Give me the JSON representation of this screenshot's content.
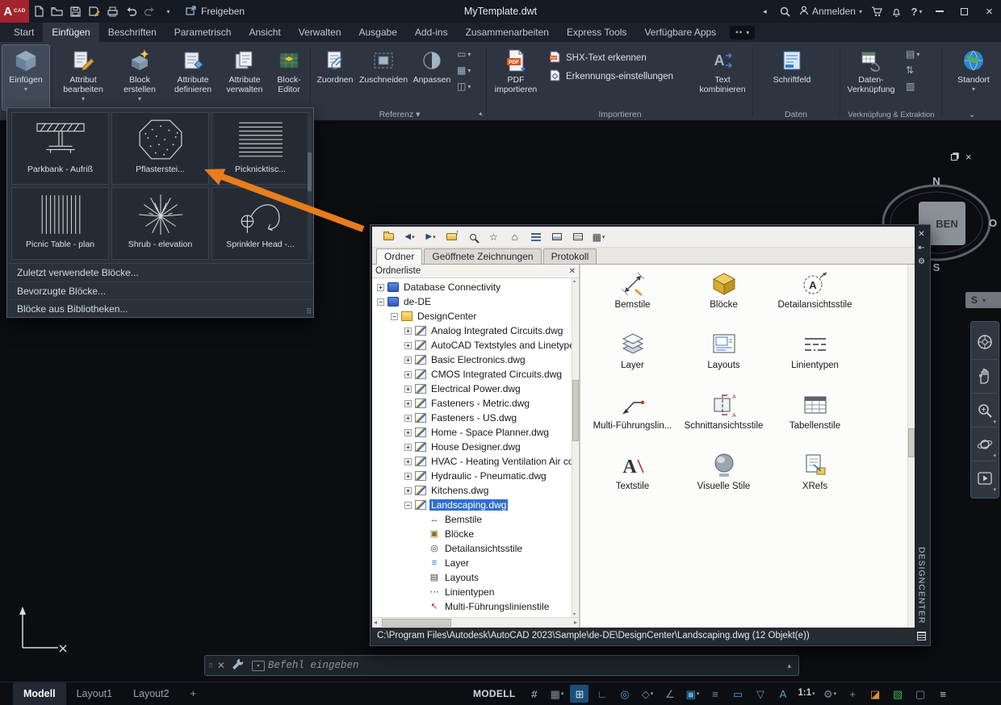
{
  "colors": {
    "annotation_arrow": "#e87d1c",
    "selection_blue": "#2f6fce",
    "status_active_blue": "#4da6e0",
    "ribbon_bg": "#2e3440",
    "titlebar_bg": "#151a23"
  },
  "titlebar": {
    "logo_letter": "A",
    "logo_sub": "CAD",
    "share_label": "Freigeben",
    "title": "MyTemplate.dwt",
    "signin_label": "Anmelden"
  },
  "tabs": [
    {
      "label": "Start"
    },
    {
      "label": "Einfügen",
      "state": "active"
    },
    {
      "label": "Beschriften"
    },
    {
      "label": "Parametrisch"
    },
    {
      "label": "Ansicht"
    },
    {
      "label": "Verwalten"
    },
    {
      "label": "Ausgabe"
    },
    {
      "label": "Add-ins"
    },
    {
      "label": "Zusammenarbeiten"
    },
    {
      "label": "Express Tools"
    },
    {
      "label": "Verfügbare Apps"
    }
  ],
  "ribbon": {
    "insert_button": "Einfügen",
    "block_buttons": [
      "Attribut bearbeiten",
      "Block erstellen",
      "Attribute definieren",
      "Attribute verwalten",
      "Block-Editor"
    ],
    "reference_buttons": [
      "Zuordnen",
      "Zuschneiden",
      "Anpassen"
    ],
    "reference_label": "Referenz",
    "pdf_button": "PDF importieren",
    "shx_buttons": [
      "SHX-Text erkennen",
      "Erkennungs-einstellungen"
    ],
    "combine_button": "Text kombinieren",
    "import_label": "Importieren",
    "field_button": "Schriftfeld",
    "data_label": "Daten",
    "datalink_button": "Daten-Verknüpfung",
    "link_label": "Verknüpfung & Extraktion",
    "location_button": "Standort"
  },
  "gallery": {
    "tiles": [
      {
        "label": "Parkbank - Aufriß",
        "icon": "bench"
      },
      {
        "label": "Pflasterstei...",
        "icon": "paver"
      },
      {
        "label": "Picknicktisc...",
        "icon": "picnic-elevation"
      },
      {
        "label": "Picnic Table - plan",
        "icon": "picnic-plan"
      },
      {
        "label": "Shrub - elevation",
        "icon": "shrub"
      },
      {
        "label": "Sprinkler Head -...",
        "icon": "sprinkler"
      }
    ],
    "menu_items": [
      "Zuletzt verwendete Blöcke...",
      "Bevorzugte Blöcke...",
      "Blöcke aus Bibliotheken..."
    ]
  },
  "canvas": {
    "viewcube": {
      "north": "N",
      "east": "O",
      "south": "S",
      "face": "BEN",
      "ucs_chip": "S"
    }
  },
  "navbar": {
    "items": [
      {
        "name": "navigation-wheel"
      },
      {
        "name": "pan"
      },
      {
        "name": "zoom"
      },
      {
        "name": "orbit"
      },
      {
        "name": "show-motion"
      }
    ]
  },
  "designcenter": {
    "toolbar_icons": [
      {
        "name": "load"
      },
      {
        "name": "back",
        "arrow": "caret"
      },
      {
        "name": "forward",
        "arrow": "caret",
        "state": "disabled"
      },
      {
        "name": "up"
      },
      {
        "name": "search-btn"
      },
      {
        "name": "favorites"
      },
      {
        "name": "home"
      },
      {
        "name": "tree-toggle",
        "state": "pressed"
      },
      {
        "name": "preview"
      },
      {
        "name": "description"
      },
      {
        "name": "views",
        "arrow": "caret"
      }
    ],
    "tabs": [
      {
        "label": "Ordner",
        "state": "active"
      },
      {
        "label": "Geöffnete Zeichnungen"
      },
      {
        "label": "Protokoll"
      }
    ],
    "tree_header": "Ordnerliste",
    "tree": [
      {
        "label": "Database Connectivity",
        "depth": 0,
        "expander": "plus",
        "icon": "db"
      },
      {
        "label": "de-DE",
        "depth": 0,
        "expander": "minus",
        "icon": "db"
      },
      {
        "label": "DesignCenter",
        "depth": 1,
        "expander": "minus",
        "icon": "folder"
      },
      {
        "label": "Analog Integrated Circuits.dwg",
        "depth": 2,
        "expander": "plus",
        "icon": "dwg"
      },
      {
        "label": "AutoCAD Textstyles and Linetypes.dwg",
        "depth": 2,
        "expander": "plus",
        "icon": "dwg"
      },
      {
        "label": "Basic Electronics.dwg",
        "depth": 2,
        "expander": "plus",
        "icon": "dwg"
      },
      {
        "label": "CMOS Integrated Circuits.dwg",
        "depth": 2,
        "expander": "plus",
        "icon": "dwg"
      },
      {
        "label": "Electrical Power.dwg",
        "depth": 2,
        "expander": "plus",
        "icon": "dwg"
      },
      {
        "label": "Fasteners - Metric.dwg",
        "depth": 2,
        "expander": "plus",
        "icon": "dwg"
      },
      {
        "label": "Fasteners - US.dwg",
        "depth": 2,
        "expander": "plus",
        "icon": "dwg"
      },
      {
        "label": "Home - Space Planner.dwg",
        "depth": 2,
        "expander": "plus",
        "icon": "dwg"
      },
      {
        "label": "House Designer.dwg",
        "depth": 2,
        "expander": "plus",
        "icon": "dwg"
      },
      {
        "label": "HVAC - Heating Ventilation Air conditioning.dwg",
        "depth": 2,
        "expander": "plus",
        "icon": "dwg"
      },
      {
        "label": "Hydraulic - Pneumatic.dwg",
        "depth": 2,
        "expander": "plus",
        "icon": "dwg"
      },
      {
        "label": "Kitchens.dwg",
        "depth": 2,
        "expander": "plus",
        "icon": "dwg"
      },
      {
        "label": "Landscaping.dwg",
        "depth": 2,
        "expander": "minus",
        "icon": "dwg",
        "state": "selected"
      },
      {
        "label": "Bemstile",
        "depth": 3,
        "expander": "none",
        "icon": "dim"
      },
      {
        "label": "Blöcke",
        "depth": 3,
        "expander": "none",
        "icon": "blockg"
      },
      {
        "label": "Detailansichtsstile",
        "depth": 3,
        "expander": "none",
        "icon": "detail"
      },
      {
        "label": "Layer",
        "depth": 3,
        "expander": "none",
        "icon": "layer"
      },
      {
        "label": "Layouts",
        "depth": 3,
        "expander": "none",
        "icon": "layout"
      },
      {
        "label": "Linientypen",
        "depth": 3,
        "expander": "none",
        "icon": "ltype"
      },
      {
        "label": "Multi-Führungslinienstile",
        "depth": 3,
        "expander": "none",
        "icon": "mleader"
      }
    ],
    "content_items": [
      {
        "label": "Bemstile",
        "icon": "dimension-style"
      },
      {
        "label": "Blöcke",
        "icon": "blocks"
      },
      {
        "label": "Detailansichtsstile",
        "icon": "detail-view-style"
      },
      {
        "label": "Layer",
        "icon": "layers"
      },
      {
        "label": "Layouts",
        "icon": "layouts"
      },
      {
        "label": "Linientypen",
        "icon": "linetypes"
      },
      {
        "label": "Multi-Führungslin...",
        "icon": "multileader-style"
      },
      {
        "label": "Schnittansichtsstile",
        "icon": "section-view-style"
      },
      {
        "label": "Tabellenstile",
        "icon": "table-style"
      },
      {
        "label": "Textstile",
        "icon": "text-style"
      },
      {
        "label": "Visuelle Stile",
        "icon": "visual-style"
      },
      {
        "label": "XRefs",
        "icon": "xrefs"
      }
    ],
    "status_text": "C:\\Program Files\\Autodesk\\AutoCAD 2023\\Sample\\de-DE\\DesignCenter\\Landscaping.dwg (12 Objekt(e))",
    "side_label": "DESIGNCENTER"
  },
  "command_line": {
    "placeholder": "Befehl eingeben"
  },
  "statusbar": {
    "model_tabs": [
      {
        "label": "Modell",
        "state": "active"
      },
      {
        "label": "Layout1"
      },
      {
        "label": "Layout2"
      },
      {
        "label": "+"
      }
    ],
    "mode_label": "MODELL",
    "toggles": [
      {
        "name": "grid-display",
        "glyph": "#",
        "state": "white"
      },
      {
        "name": "snap-mode",
        "glyph": "▦",
        "state": "off",
        "arrow": "caret"
      },
      {
        "name": "infer-constraints",
        "glyph": "⊞",
        "state": "pressed"
      },
      {
        "name": "ortho-mode",
        "glyph": "∟",
        "state": "off"
      },
      {
        "name": "polar-tracking",
        "glyph": "◎",
        "state": "on"
      },
      {
        "name": "isometric-drafting",
        "glyph": "◇",
        "state": "off",
        "arrow": "caret"
      },
      {
        "name": "object-snap-tracking",
        "glyph": "∠",
        "state": "off"
      },
      {
        "name": "object-snap",
        "glyph": "▣",
        "state": "on",
        "arrow": "caret"
      },
      {
        "name": "lineweight-display",
        "glyph": "≡",
        "state": "off"
      },
      {
        "name": "selection-cycling",
        "glyph": "▭",
        "state": "on"
      },
      {
        "name": "selection-filter",
        "glyph": "▽",
        "state": "off"
      },
      {
        "name": "annotation-visibility",
        "glyph": "A",
        "state": "on"
      },
      {
        "name": "annotation-scale",
        "glyph": "1:1",
        "state": "white wide",
        "arrow": "caret"
      },
      {
        "name": "workspace-switching",
        "glyph": "⚙",
        "state": "off",
        "arrow": "caret"
      },
      {
        "name": "add-scales",
        "glyph": "+",
        "state": "off"
      },
      {
        "name": "object-isolation",
        "glyph": "◪",
        "state": "orange"
      },
      {
        "name": "graphics-performance",
        "glyph": "▧",
        "state": "green"
      },
      {
        "name": "clean-screen",
        "glyph": "▢",
        "state": "off"
      },
      {
        "name": "customization",
        "glyph": "≡",
        "state": "white"
      }
    ]
  }
}
